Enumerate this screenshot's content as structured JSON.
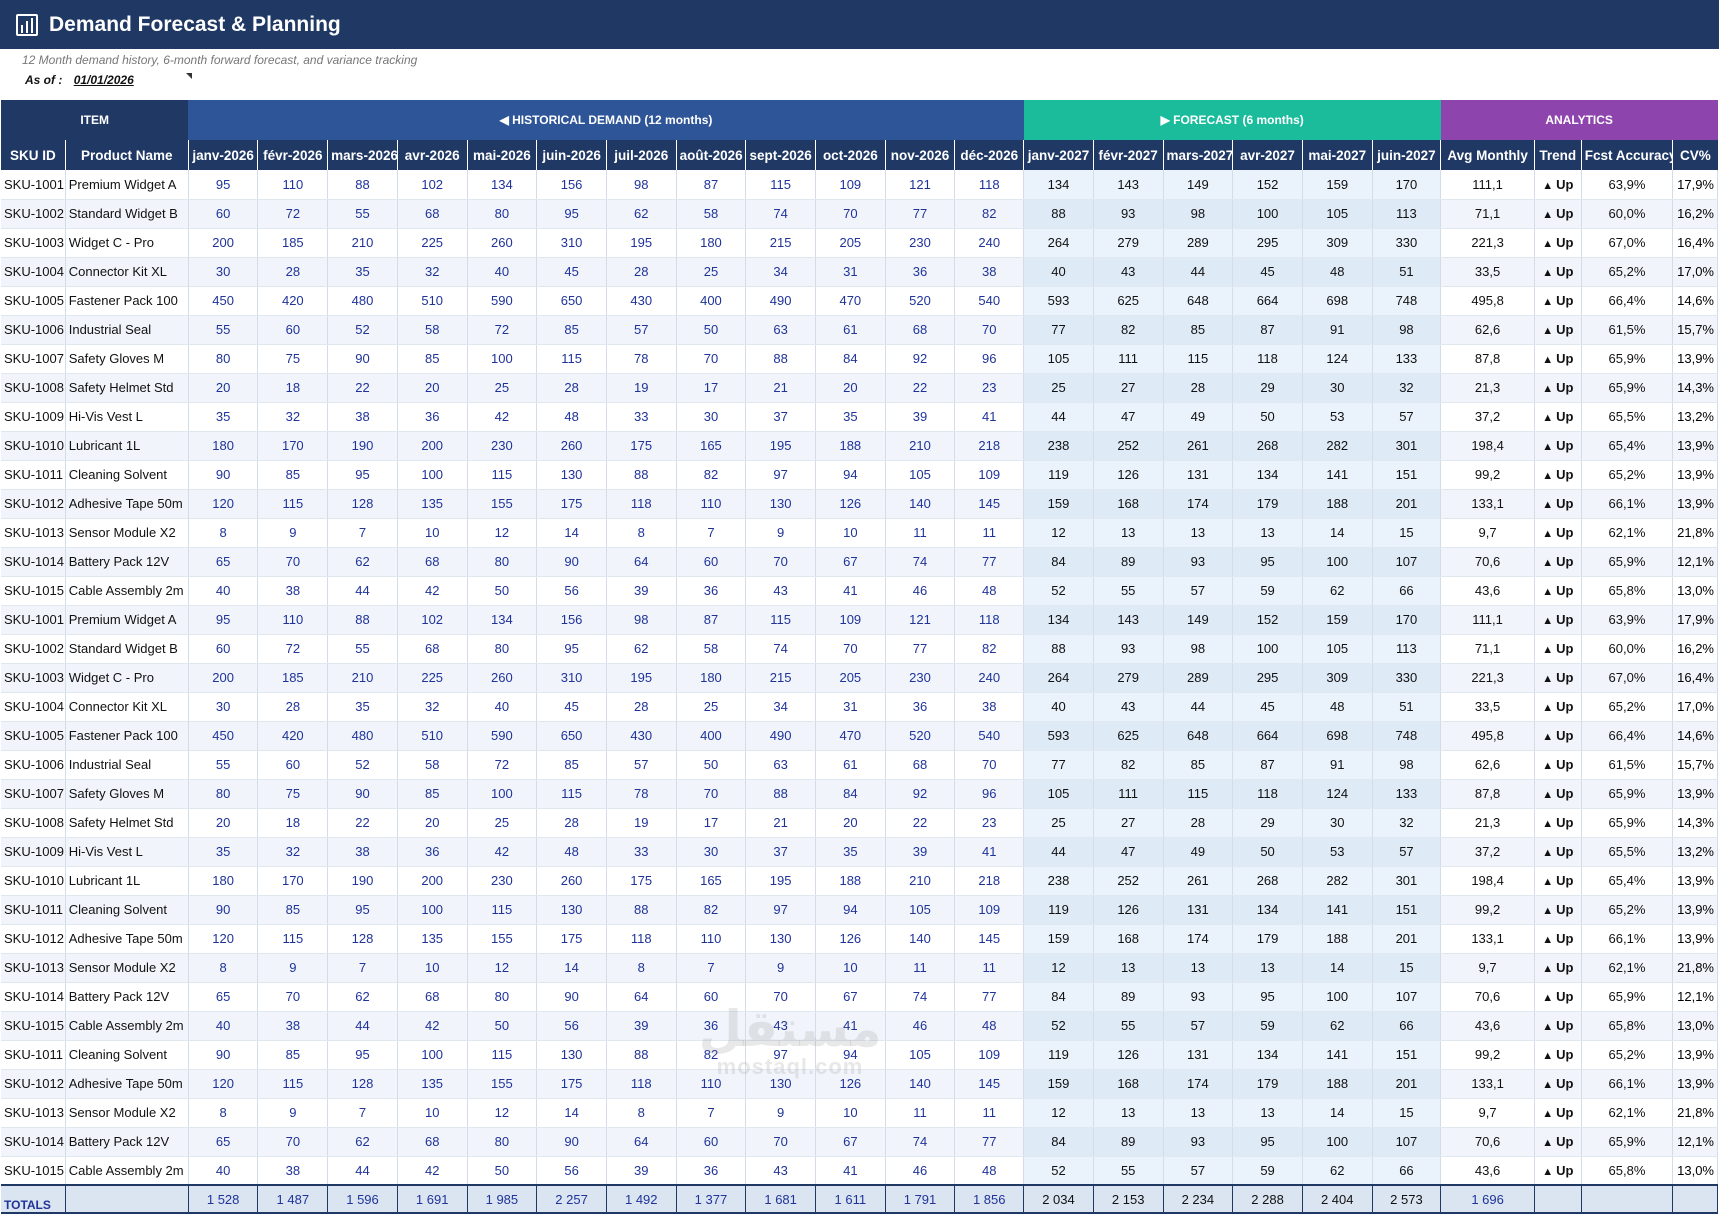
{
  "title": "Demand Forecast & Planning",
  "subtitle": "12 Month demand history, 6-month forward forecast, and variance tracking",
  "as_of": {
    "label": "As of :",
    "value": "01/01/2026"
  },
  "groups": {
    "item": "ITEM",
    "historical": "◀ HISTORICAL DEMAND (12 months)",
    "forecast": "▶ FORECAST (6 months)",
    "analytics": "ANALYTICS"
  },
  "columns": {
    "sku": "SKU ID",
    "name": "Product Name",
    "history": [
      "janv-2026",
      "févr-2026",
      "mars-2026",
      "avr-2026",
      "mai-2026",
      "juin-2026",
      "juil-2026",
      "août-2026",
      "sept-2026",
      "oct-2026",
      "nov-2026",
      "déc-2026"
    ],
    "forecast": [
      "janv-2027",
      "févr-2027",
      "mars-2027",
      "avr-2027",
      "mai-2027",
      "juin-2027"
    ],
    "avg": "Avg Monthly",
    "trend": "Trend",
    "accuracy": "Fcst Accuracy",
    "cv": "CV%"
  },
  "trend_arrow": "▲",
  "products": {
    "SKU-1001": {
      "name": "Premium Widget A",
      "hist": [
        95,
        110,
        88,
        102,
        134,
        156,
        98,
        87,
        115,
        109,
        121,
        118
      ],
      "fc": [
        134,
        143,
        149,
        152,
        159,
        170
      ],
      "avg": "111,1",
      "trend": "Up",
      "acc": "63,9%",
      "cv": "17,9%"
    },
    "SKU-1002": {
      "name": "Standard Widget B",
      "hist": [
        60,
        72,
        55,
        68,
        80,
        95,
        62,
        58,
        74,
        70,
        77,
        82
      ],
      "fc": [
        88,
        93,
        98,
        100,
        105,
        113
      ],
      "avg": "71,1",
      "trend": "Up",
      "acc": "60,0%",
      "cv": "16,2%"
    },
    "SKU-1003": {
      "name": "Widget C - Pro",
      "hist": [
        200,
        185,
        210,
        225,
        260,
        310,
        195,
        180,
        215,
        205,
        230,
        240
      ],
      "fc": [
        264,
        279,
        289,
        295,
        309,
        330
      ],
      "avg": "221,3",
      "trend": "Up",
      "acc": "67,0%",
      "cv": "16,4%"
    },
    "SKU-1004": {
      "name": "Connector Kit XL",
      "hist": [
        30,
        28,
        35,
        32,
        40,
        45,
        28,
        25,
        34,
        31,
        36,
        38
      ],
      "fc": [
        40,
        43,
        44,
        45,
        48,
        51
      ],
      "avg": "33,5",
      "trend": "Up",
      "acc": "65,2%",
      "cv": "17,0%"
    },
    "SKU-1005": {
      "name": "Fastener Pack 100",
      "hist": [
        450,
        420,
        480,
        510,
        590,
        650,
        430,
        400,
        490,
        470,
        520,
        540
      ],
      "fc": [
        593,
        625,
        648,
        664,
        698,
        748
      ],
      "avg": "495,8",
      "trend": "Up",
      "acc": "66,4%",
      "cv": "14,6%"
    },
    "SKU-1006": {
      "name": "Industrial Seal",
      "hist": [
        55,
        60,
        52,
        58,
        72,
        85,
        57,
        50,
        63,
        61,
        68,
        70
      ],
      "fc": [
        77,
        82,
        85,
        87,
        91,
        98
      ],
      "avg": "62,6",
      "trend": "Up",
      "acc": "61,5%",
      "cv": "15,7%"
    },
    "SKU-1007": {
      "name": "Safety Gloves M",
      "hist": [
        80,
        75,
        90,
        85,
        100,
        115,
        78,
        70,
        88,
        84,
        92,
        96
      ],
      "fc": [
        105,
        111,
        115,
        118,
        124,
        133
      ],
      "avg": "87,8",
      "trend": "Up",
      "acc": "65,9%",
      "cv": "13,9%"
    },
    "SKU-1008": {
      "name": "Safety Helmet Std",
      "hist": [
        20,
        18,
        22,
        20,
        25,
        28,
        19,
        17,
        21,
        20,
        22,
        23
      ],
      "fc": [
        25,
        27,
        28,
        29,
        30,
        32
      ],
      "avg": "21,3",
      "trend": "Up",
      "acc": "65,9%",
      "cv": "14,3%"
    },
    "SKU-1009": {
      "name": "Hi-Vis Vest L",
      "hist": [
        35,
        32,
        38,
        36,
        42,
        48,
        33,
        30,
        37,
        35,
        39,
        41
      ],
      "fc": [
        44,
        47,
        49,
        50,
        53,
        57
      ],
      "avg": "37,2",
      "trend": "Up",
      "acc": "65,5%",
      "cv": "13,2%"
    },
    "SKU-1010": {
      "name": "Lubricant 1L",
      "hist": [
        180,
        170,
        190,
        200,
        230,
        260,
        175,
        165,
        195,
        188,
        210,
        218
      ],
      "fc": [
        238,
        252,
        261,
        268,
        282,
        301
      ],
      "avg": "198,4",
      "trend": "Up",
      "acc": "65,4%",
      "cv": "13,9%"
    },
    "SKU-1011": {
      "name": "Cleaning Solvent",
      "hist": [
        90,
        85,
        95,
        100,
        115,
        130,
        88,
        82,
        97,
        94,
        105,
        109
      ],
      "fc": [
        119,
        126,
        131,
        134,
        141,
        151
      ],
      "avg": "99,2",
      "trend": "Up",
      "acc": "65,2%",
      "cv": "13,9%"
    },
    "SKU-1012": {
      "name": "Adhesive Tape 50m",
      "hist": [
        120,
        115,
        128,
        135,
        155,
        175,
        118,
        110,
        130,
        126,
        140,
        145
      ],
      "fc": [
        159,
        168,
        174,
        179,
        188,
        201
      ],
      "avg": "133,1",
      "trend": "Up",
      "acc": "66,1%",
      "cv": "13,9%"
    },
    "SKU-1013": {
      "name": "Sensor Module X2",
      "hist": [
        8,
        9,
        7,
        10,
        12,
        14,
        8,
        7,
        9,
        10,
        11,
        11
      ],
      "fc": [
        12,
        13,
        13,
        13,
        14,
        15
      ],
      "avg": "9,7",
      "trend": "Up",
      "acc": "62,1%",
      "cv": "21,8%"
    },
    "SKU-1014": {
      "name": "Battery Pack 12V",
      "hist": [
        65,
        70,
        62,
        68,
        80,
        90,
        64,
        60,
        70,
        67,
        74,
        77
      ],
      "fc": [
        84,
        89,
        93,
        95,
        100,
        107
      ],
      "avg": "70,6",
      "trend": "Up",
      "acc": "65,9%",
      "cv": "12,1%"
    },
    "SKU-1015": {
      "name": "Cable Assembly 2m",
      "hist": [
        40,
        38,
        44,
        42,
        50,
        56,
        39,
        36,
        43,
        41,
        46,
        48
      ],
      "fc": [
        52,
        55,
        57,
        59,
        62,
        66
      ],
      "avg": "43,6",
      "trend": "Up",
      "acc": "65,8%",
      "cv": "13,0%"
    }
  },
  "rows": [
    "SKU-1001",
    "SKU-1002",
    "SKU-1003",
    "SKU-1004",
    "SKU-1005",
    "SKU-1006",
    "SKU-1007",
    "SKU-1008",
    "SKU-1009",
    "SKU-1010",
    "SKU-1011",
    "SKU-1012",
    "SKU-1013",
    "SKU-1014",
    "SKU-1015",
    "SKU-1001",
    "SKU-1002",
    "SKU-1003",
    "SKU-1004",
    "SKU-1005",
    "SKU-1006",
    "SKU-1007",
    "SKU-1008",
    "SKU-1009",
    "SKU-1010",
    "SKU-1011",
    "SKU-1012",
    "SKU-1013",
    "SKU-1014",
    "SKU-1015",
    "SKU-1011",
    "SKU-1012",
    "SKU-1013",
    "SKU-1014",
    "SKU-1015"
  ],
  "totals": {
    "label": "TOTALS",
    "history": [
      "1 528",
      "1 487",
      "1 596",
      "1 691",
      "1 985",
      "2 257",
      "1 492",
      "1 377",
      "1 681",
      "1 611",
      "1 791",
      "1 856"
    ],
    "forecast": [
      "2 034",
      "2 153",
      "2 234",
      "2 288",
      "2 404",
      "2 573"
    ],
    "avg": "1 696"
  },
  "watermark": {
    "arabic": "مستقل",
    "latin": "mostaql.com"
  },
  "colors": {
    "title_bar": "#1f3864",
    "historical": "#2e5597",
    "forecast": "#1abc9c",
    "analytics": "#8e44ad",
    "value_text": "#1f3399"
  }
}
